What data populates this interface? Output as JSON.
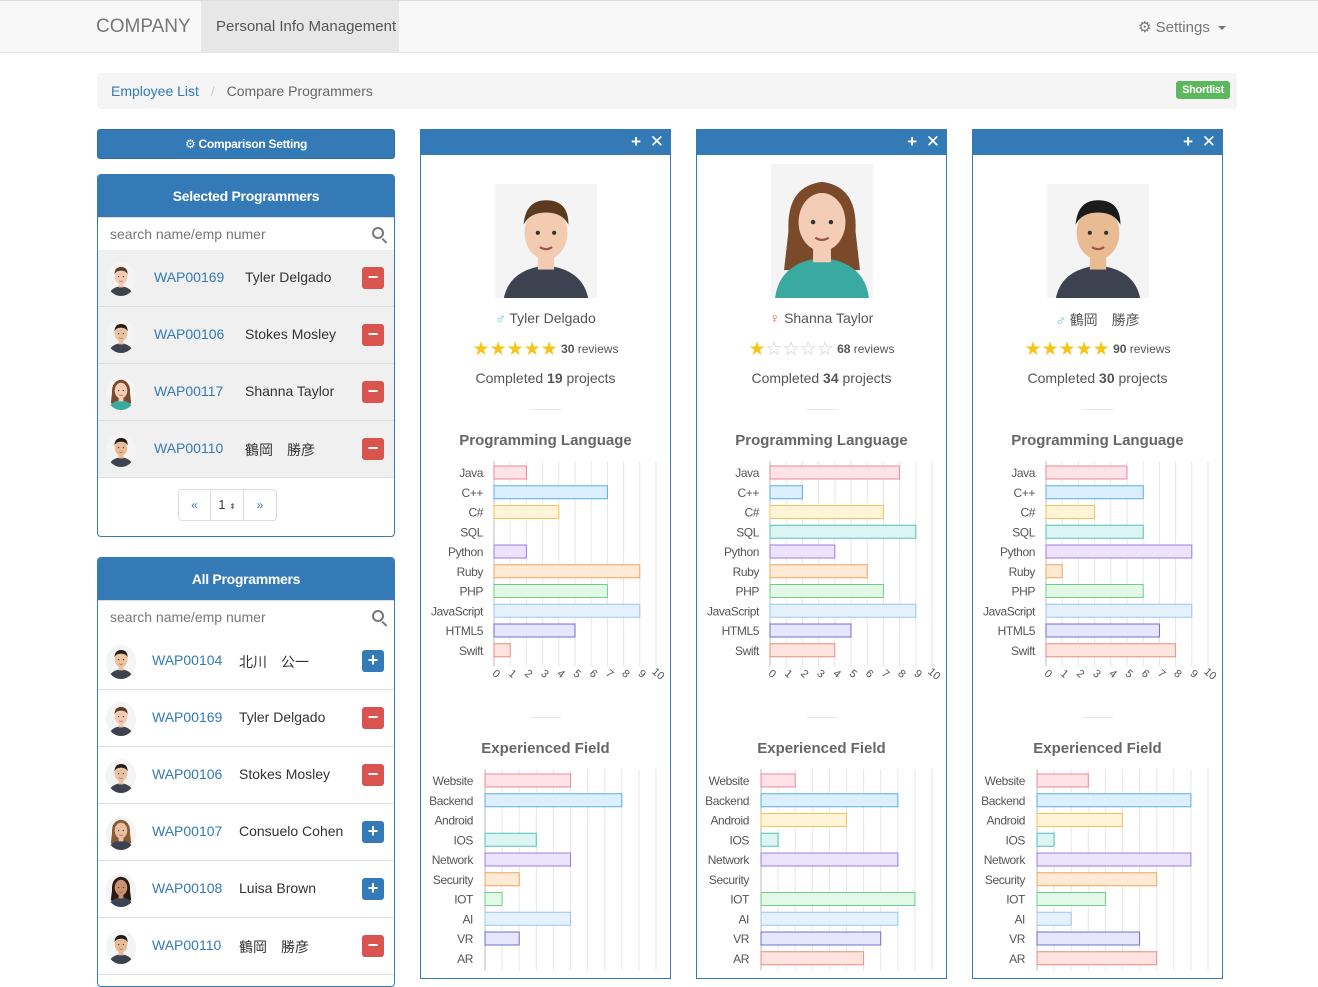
{
  "navbar": {
    "brand": "COMPANY",
    "active_tab": "Personal Info Management",
    "settings_label": "Settings"
  },
  "breadcrumb": {
    "link": "Employee List",
    "current": "Compare Programmers",
    "shortlist_label": "Shortlist"
  },
  "comparison_setting_label": "Comparison Setting",
  "selected_panel": {
    "title": "Selected Programmers",
    "search_placeholder": "search name/emp numer",
    "rows": [
      {
        "emp": "WAP00169",
        "name": "Tyler Delgado"
      },
      {
        "emp": "WAP00106",
        "name": "Stokes Mosley"
      },
      {
        "emp": "WAP00117",
        "name": "Shanna Taylor"
      },
      {
        "emp": "WAP00110",
        "name": "鶴岡　勝彦"
      }
    ],
    "pager": {
      "prev": "«",
      "page": "1",
      "next": "»"
    }
  },
  "all_panel": {
    "title": "All Programmers",
    "search_placeholder": "search name/emp numer",
    "rows": [
      {
        "emp": "WAP00104",
        "name": "北川　公一"
      },
      {
        "emp": "WAP00169",
        "name": "Tyler Delgado"
      },
      {
        "emp": "WAP00106",
        "name": "Stokes Mosley"
      },
      {
        "emp": "WAP00107",
        "name": "Consuelo Cohen"
      },
      {
        "emp": "WAP00108",
        "name": "Luisa Brown"
      },
      {
        "emp": "WAP00110",
        "name": "鶴岡　勝彦"
      }
    ]
  },
  "cards": [
    {
      "name": "Tyler Delgado",
      "gender": "male",
      "stars": 5,
      "reviews": "30",
      "reviews_label": "reviews",
      "completed_prefix": "Completed",
      "projects": "19",
      "completed_suffix": "projects"
    },
    {
      "name": "Shanna Taylor",
      "gender": "female",
      "stars": 1,
      "reviews": "68",
      "reviews_label": "reviews",
      "completed_prefix": "Completed",
      "projects": "34",
      "completed_suffix": "projects"
    },
    {
      "name": "鶴岡　勝彦",
      "gender": "male",
      "stars": 5,
      "reviews": "90",
      "reviews_label": "reviews",
      "completed_prefix": "Completed",
      "projects": "30",
      "completed_suffix": "projects"
    }
  ],
  "colors": {
    "primary": "#337ab7",
    "danger": "#d9534f",
    "success": "#5cb85c",
    "star": "#f5c518"
  },
  "chart_data": [
    {
      "type": "bar",
      "orientation": "horizontal",
      "title": "Programming Language",
      "owner": "Tyler Delgado",
      "categories": [
        "Java",
        "C++",
        "C#",
        "SQL",
        "Python",
        "Ruby",
        "PHP",
        "JavaScript",
        "HTML5",
        "Swift"
      ],
      "values": [
        2,
        7,
        4,
        0,
        2,
        9,
        7,
        9,
        5,
        1
      ],
      "xlim": [
        0,
        10
      ],
      "xticks": [
        "0",
        "1",
        "2",
        "3",
        "4",
        "5",
        "6",
        "7",
        "8",
        "9",
        "10"
      ],
      "grid": true
    },
    {
      "type": "bar",
      "orientation": "horizontal",
      "title": "Programming Language",
      "owner": "Shanna Taylor",
      "categories": [
        "Java",
        "C++",
        "C#",
        "SQL",
        "Python",
        "Ruby",
        "PHP",
        "JavaScript",
        "HTML5",
        "Swift"
      ],
      "values": [
        8,
        2,
        7,
        9,
        4,
        6,
        7,
        9,
        5,
        4
      ],
      "xlim": [
        0,
        10
      ],
      "xticks": [
        "0",
        "1",
        "2",
        "3",
        "4",
        "5",
        "6",
        "7",
        "8",
        "9",
        "10"
      ],
      "grid": true
    },
    {
      "type": "bar",
      "orientation": "horizontal",
      "title": "Programming Language",
      "owner": "鶴岡　勝彦",
      "categories": [
        "Java",
        "C++",
        "C#",
        "SQL",
        "Python",
        "Ruby",
        "PHP",
        "JavaScript",
        "HTML5",
        "Swift"
      ],
      "values": [
        5,
        6,
        3,
        6,
        9,
        1,
        6,
        9,
        7,
        8
      ],
      "xlim": [
        0,
        10
      ],
      "xticks": [
        "0",
        "1",
        "2",
        "3",
        "4",
        "5",
        "6",
        "7",
        "8",
        "9",
        "10"
      ],
      "grid": true
    },
    {
      "type": "bar",
      "orientation": "horizontal",
      "title": "Experienced Field",
      "owner": "Tyler Delgado",
      "categories": [
        "Website",
        "Backend",
        "Android",
        "IOS",
        "Network",
        "Security",
        "IOT",
        "AI",
        "VR",
        "AR"
      ],
      "values": [
        5,
        8,
        0,
        3,
        5,
        2,
        1,
        5,
        2,
        0
      ],
      "xlim": [
        0,
        10
      ],
      "grid": true
    },
    {
      "type": "bar",
      "orientation": "horizontal",
      "title": "Experienced Field",
      "owner": "Shanna Taylor",
      "categories": [
        "Website",
        "Backend",
        "Android",
        "IOS",
        "Network",
        "Security",
        "IOT",
        "AI",
        "VR",
        "AR"
      ],
      "values": [
        2,
        8,
        5,
        1,
        8,
        0,
        9,
        8,
        7,
        6
      ],
      "xlim": [
        0,
        10
      ],
      "grid": true
    },
    {
      "type": "bar",
      "orientation": "horizontal",
      "title": "Experienced Field",
      "owner": "鶴岡　勝彦",
      "categories": [
        "Website",
        "Backend",
        "Android",
        "IOS",
        "Network",
        "Security",
        "IOT",
        "AI",
        "VR",
        "AR"
      ],
      "values": [
        3,
        9,
        5,
        1,
        9,
        7,
        4,
        2,
        6,
        7
      ],
      "xlim": [
        0,
        10
      ],
      "grid": true
    }
  ]
}
